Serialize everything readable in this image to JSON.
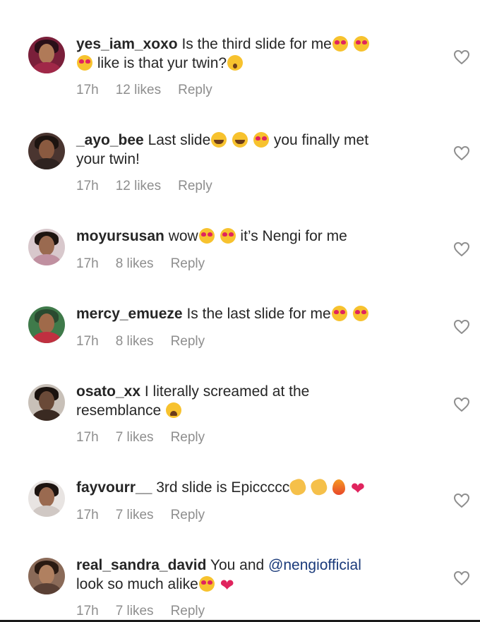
{
  "comments": [
    {
      "username": "yes_iam_xoxo",
      "text_1": " Is the third slide for me",
      "text_2": " like is that yur twin?",
      "time": "17h",
      "likes": "12 likes",
      "reply": "Reply"
    },
    {
      "username": "_ayo_bee",
      "text_1": " Last slide",
      "text_2": " you finally met",
      "text_3": "your twin!",
      "time": "17h",
      "likes": "12 likes",
      "reply": "Reply"
    },
    {
      "username": "moyursusan",
      "text_1": " wow",
      "text_2": " it’s Nengi for me",
      "time": "17h",
      "likes": "8 likes",
      "reply": "Reply"
    },
    {
      "username": "mercy_emueze",
      "text_1": " Is the last slide for me",
      "time": "17h",
      "likes": "8 likes",
      "reply": "Reply"
    },
    {
      "username": "osato_xx",
      "text_1": " I literally screamed at the resemblance ",
      "time": "17h",
      "likes": "7 likes",
      "reply": "Reply"
    },
    {
      "username": "fayvourr__",
      "text_1": " 3rd slide is Epiccccc",
      "time": "17h",
      "likes": "7 likes",
      "reply": "Reply"
    },
    {
      "username": "real_sandra_david",
      "text_1": " You and ",
      "mention": "@nengiofficial",
      "text_2": "look so much alike",
      "time": "17h",
      "likes": "7 likes",
      "reply": "Reply"
    }
  ],
  "icons": {
    "like": "heart-outline-icon"
  },
  "colors": {
    "text": "#262626",
    "meta": "#8e8e8e",
    "mention": "#1a3a7a",
    "heart": "#e0245e"
  }
}
